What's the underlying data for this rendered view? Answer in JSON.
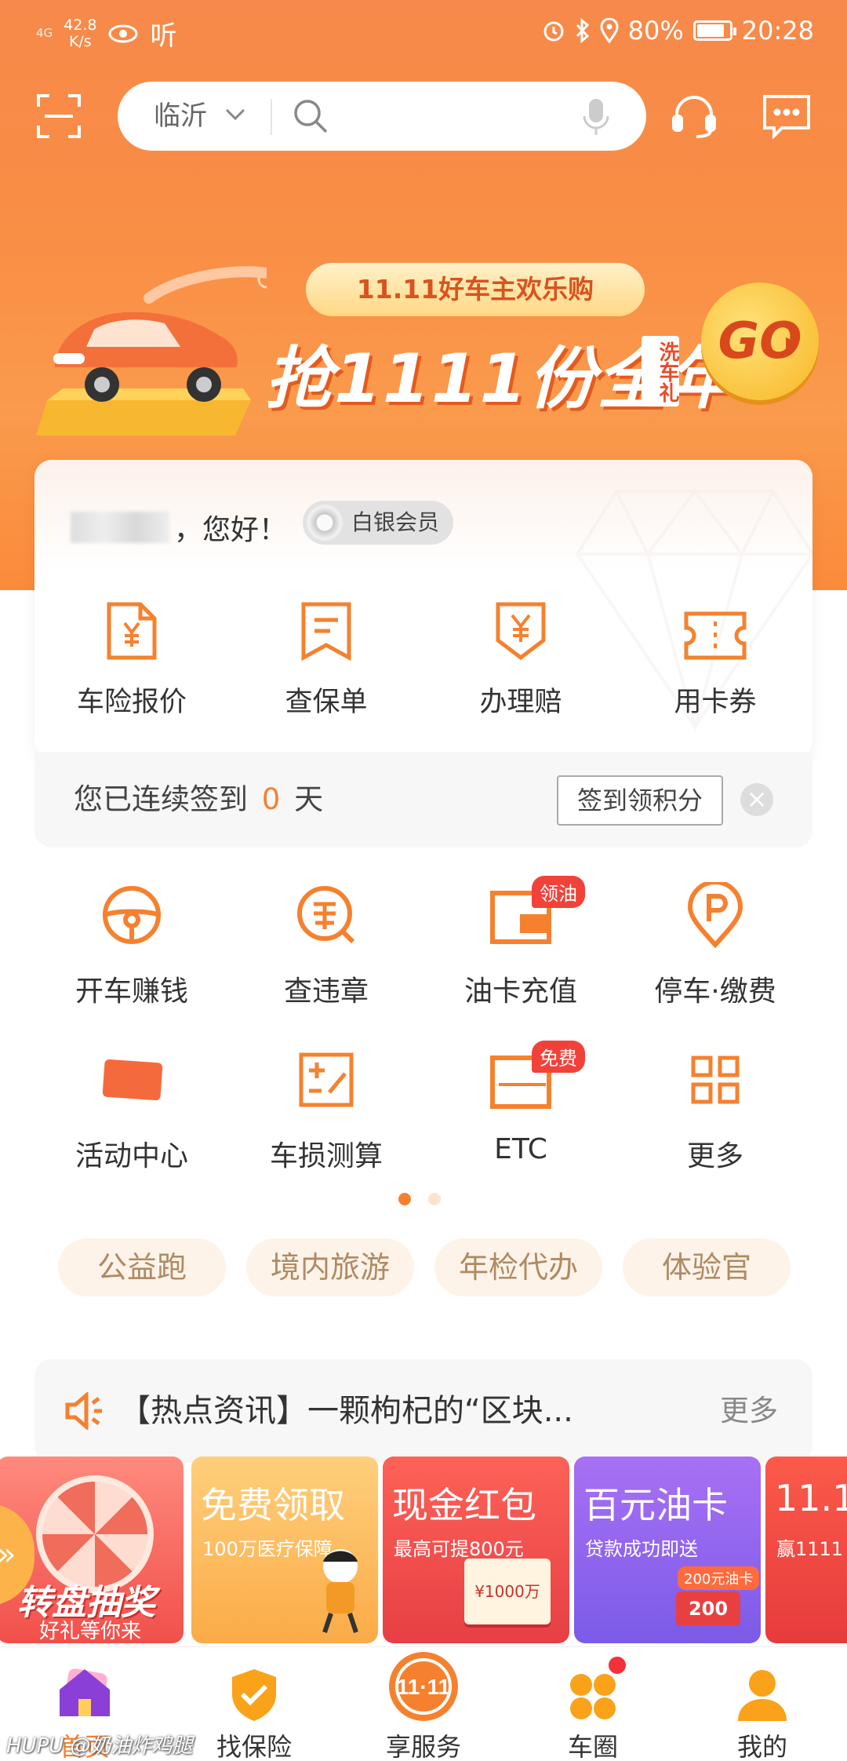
{
  "status_bar": {
    "network": "4G",
    "speed_value": "42.8",
    "speed_unit": "K/s",
    "app_text": "听",
    "battery": "80%",
    "time": "20:28"
  },
  "search": {
    "city": "临沂"
  },
  "banner": {
    "tag": "11.11好车主欢乐购",
    "main": "抢1111份全年",
    "side": "洗车礼",
    "go": "GO"
  },
  "member": {
    "greeting": "，您好！",
    "level": "白银会员"
  },
  "quick_actions": [
    {
      "label": "车险报价",
      "icon": "yen-document-icon"
    },
    {
      "label": "查保单",
      "icon": "policy-icon"
    },
    {
      "label": "办理赔",
      "icon": "yen-shield-icon"
    },
    {
      "label": "用卡券",
      "icon": "ticket-icon"
    }
  ],
  "signin": {
    "prefix": "您已连续签到",
    "count": "0",
    "suffix": "天",
    "button": "签到领积分"
  },
  "services": [
    {
      "label": "开车赚钱",
      "icon": "steering-wheel-icon",
      "badge": ""
    },
    {
      "label": "查违章",
      "icon": "violation-icon",
      "badge": ""
    },
    {
      "label": "油卡充值",
      "icon": "fuel-card-icon",
      "badge": "领油"
    },
    {
      "label": "停车·缴费",
      "icon": "parking-icon",
      "badge": ""
    },
    {
      "label": "活动中心",
      "icon": "activity-icon",
      "badge": ""
    },
    {
      "label": "车损测算",
      "icon": "calculator-icon",
      "badge": ""
    },
    {
      "label": "ETC",
      "icon": "etc-icon",
      "badge": "免费"
    },
    {
      "label": "更多",
      "icon": "grid-icon",
      "badge": ""
    }
  ],
  "chips": [
    "公益跑",
    "境内旅游",
    "年检代办",
    "体验官"
  ],
  "news": {
    "text": "【热点资讯】一颗枸杞的“区块...",
    "more": "更多"
  },
  "promos": [
    {
      "title": "转盘抽奖",
      "sub": "好礼等你来"
    },
    {
      "title": "免费领取",
      "sub": "100万医疗保障"
    },
    {
      "title": "现金红包",
      "sub": "最高可提800元",
      "note": "¥1000万"
    },
    {
      "title": "百元油卡",
      "sub": "贷款成功即送",
      "tag": "200元油卡",
      "note": "200"
    },
    {
      "title": "11.1",
      "sub": "赢1111"
    }
  ],
  "nav": [
    {
      "label": "首页",
      "icon": "home-icon"
    },
    {
      "label": "找保险",
      "icon": "shield-check-icon"
    },
    {
      "label": "享服务",
      "icon": "double-eleven-icon"
    },
    {
      "label": "车圈",
      "icon": "flower-icon"
    },
    {
      "label": "我的",
      "icon": "person-icon"
    }
  ],
  "watermark": "HUPU @奶油炸鸡腿",
  "colors": {
    "accent": "#f5812f",
    "hero": "#f98e45",
    "badge_red": "#f1423a"
  }
}
